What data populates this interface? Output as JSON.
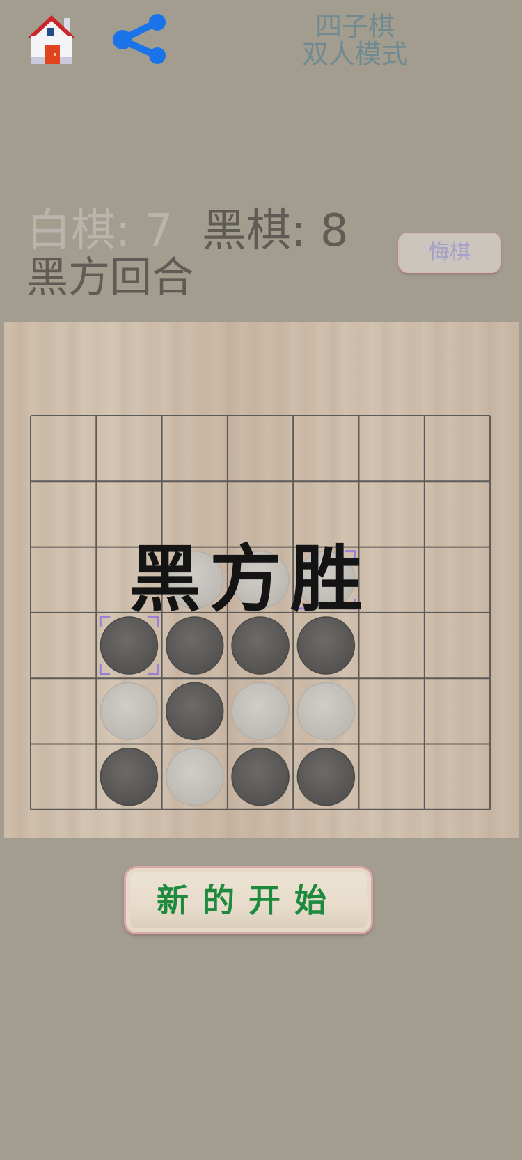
{
  "header": {
    "title_line1": "四子棋",
    "title_line2": "双人模式",
    "home_icon": "home-icon",
    "share_icon": "share-icon"
  },
  "status": {
    "white_score": "白棋: 7",
    "black_score": "黑棋: 8",
    "turn": "黑方回合",
    "undo_label": "悔棋"
  },
  "board": {
    "cols": 7,
    "rows": 6,
    "cells": [
      [
        null,
        null,
        null,
        null,
        null,
        null,
        null
      ],
      [
        null,
        null,
        null,
        null,
        null,
        null,
        null
      ],
      [
        null,
        null,
        "white",
        "white",
        "white",
        null,
        null
      ],
      [
        null,
        "black",
        "black",
        "black",
        "black",
        null,
        null
      ],
      [
        null,
        "white",
        "black",
        "white",
        "white",
        null,
        null
      ],
      [
        null,
        "black",
        "white",
        "black",
        "black",
        null,
        null
      ]
    ],
    "highlighted": [
      [
        3,
        1
      ],
      [
        2,
        4
      ]
    ],
    "winner_text": "黑方胜"
  },
  "new_game_label": "新的开始",
  "colors": {
    "background": "#a39d8f",
    "black_piece": "#5f5d5b",
    "white_piece": "#c4c0bb",
    "highlight": "#9b7fd6",
    "new_game_text": "#1d8a3d"
  }
}
